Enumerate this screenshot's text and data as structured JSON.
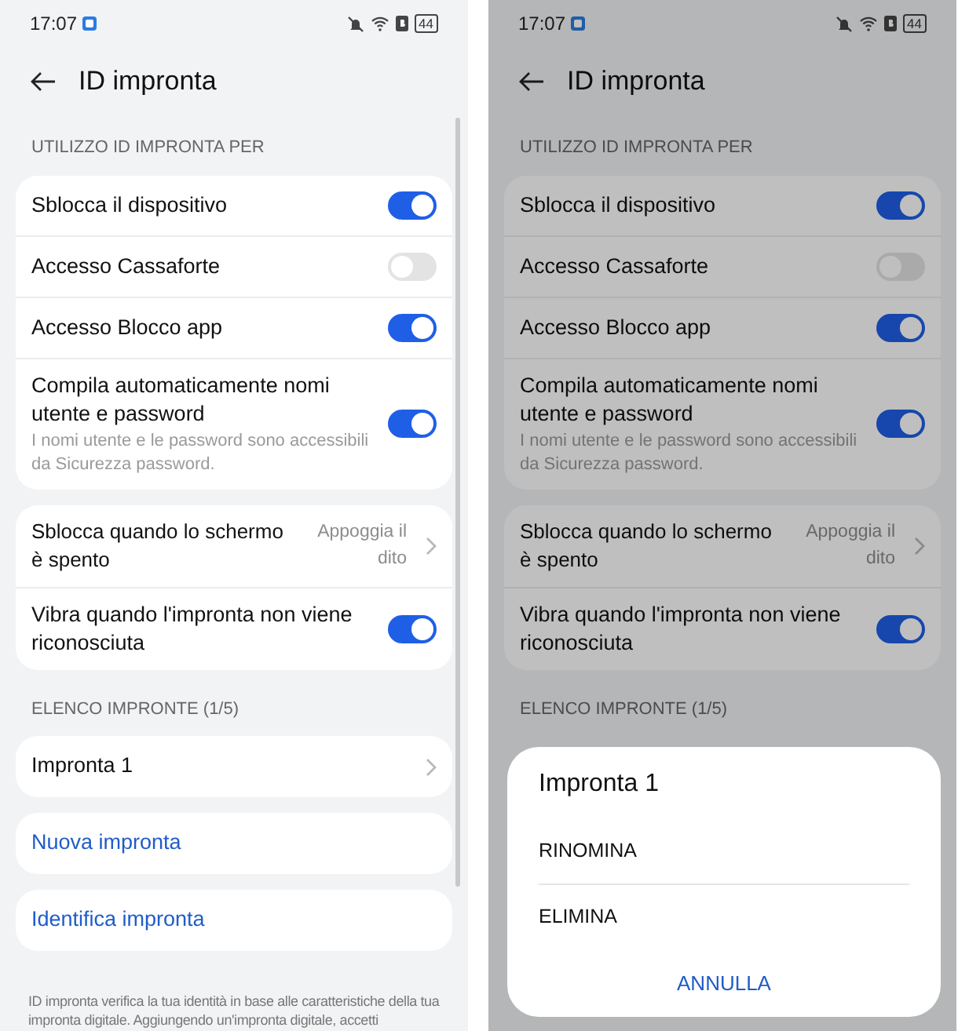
{
  "screens": [
    {
      "status_bar": {
        "time": "17:07",
        "battery": "44"
      },
      "title": "ID impronta",
      "scrollbar": true,
      "blocks": [
        {
          "kind": "header",
          "text": "UTILIZZO ID IMPRONTA PER"
        },
        {
          "kind": "card",
          "rows": [
            {
              "kind": "toggle",
              "label": "Sblocca il dispositivo",
              "on": true
            },
            {
              "kind": "toggle",
              "label": "Accesso Cassaforte",
              "on": false
            },
            {
              "kind": "toggle",
              "label": "Accesso Blocco app",
              "on": true
            },
            {
              "kind": "toggle",
              "label": "Compila automaticamente nomi utente e password",
              "description": "I nomi utente e le password sono accessibili da Sicurezza password.",
              "on": true
            }
          ]
        },
        {
          "kind": "card",
          "rows": [
            {
              "kind": "value",
              "label": "Sblocca quando lo schermo è spento",
              "value": "Appoggia il dito"
            },
            {
              "kind": "toggle",
              "label": "Vibra quando l'impronta non viene riconosciuta",
              "on": true
            }
          ]
        },
        {
          "kind": "header",
          "text": "ELENCO IMPRONTE (1/5)"
        },
        {
          "kind": "card",
          "rows": [
            {
              "kind": "nav",
              "label": "Impronta 1"
            }
          ]
        },
        {
          "kind": "card",
          "rows": [
            {
              "kind": "action",
              "label": "Nuova impronta"
            }
          ]
        },
        {
          "kind": "card",
          "rows": [
            {
              "kind": "action",
              "label": "Identifica impronta"
            }
          ]
        }
      ],
      "footer": "ID impronta verifica la tua identità in base alle caratteristiche della tua impronta digitale. Aggiungendo un'impronta digitale, accetti"
    },
    {
      "status_bar": {
        "time": "17:07",
        "battery": "44"
      },
      "title": "ID impronta",
      "scrollbar": false,
      "blocks": [
        {
          "kind": "header",
          "text": "UTILIZZO ID IMPRONTA PER"
        },
        {
          "kind": "card",
          "rows": [
            {
              "kind": "toggle",
              "label": "Sblocca il dispositivo",
              "on": true
            },
            {
              "kind": "toggle",
              "label": "Accesso Cassaforte",
              "on": false
            },
            {
              "kind": "toggle",
              "label": "Accesso Blocco app",
              "on": true
            },
            {
              "kind": "toggle",
              "label": "Compila automaticamente nomi utente e password",
              "description": "I nomi utente e le password sono accessibili da Sicurezza password.",
              "on": true
            }
          ]
        },
        {
          "kind": "card",
          "rows": [
            {
              "kind": "value",
              "label": "Sblocca quando lo schermo è spento",
              "value": "Appoggia il dito"
            },
            {
              "kind": "toggle",
              "label": "Vibra quando l'impronta non viene riconosciuta",
              "on": true
            }
          ]
        },
        {
          "kind": "header",
          "text": "ELENCO IMPRONTE (1/5)"
        }
      ],
      "dialog": {
        "title": "Impronta 1",
        "options": [
          "RINOMINA",
          "ELIMINA"
        ],
        "cancel": "ANNULLA"
      }
    }
  ]
}
